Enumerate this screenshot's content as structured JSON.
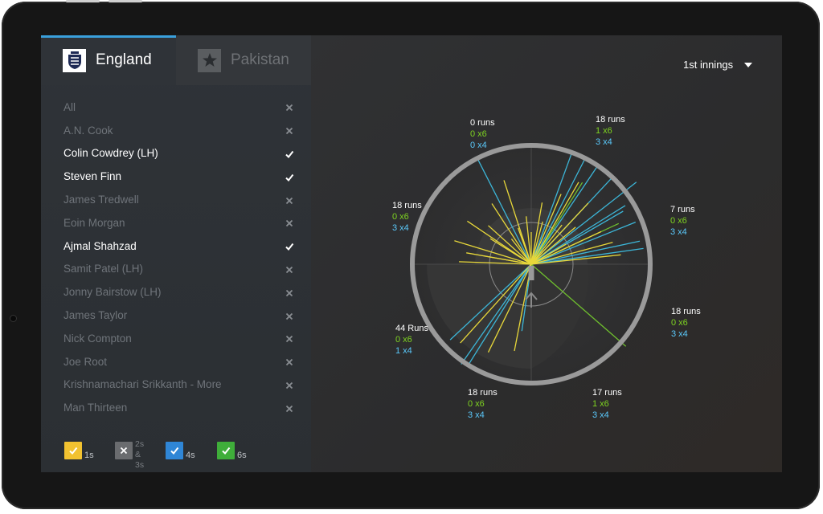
{
  "teams": [
    {
      "name": "England",
      "selected": true
    },
    {
      "name": "Pakistan",
      "selected": false
    }
  ],
  "innings": "1st innings",
  "players": [
    {
      "name": "All",
      "selected": false
    },
    {
      "name": "A.N. Cook",
      "selected": false
    },
    {
      "name": "Colin Cowdrey (LH)",
      "selected": true
    },
    {
      "name": "Steven Finn",
      "selected": true
    },
    {
      "name": "James Tredwell",
      "selected": false
    },
    {
      "name": "Eoin Morgan",
      "selected": false
    },
    {
      "name": "Ajmal Shahzad",
      "selected": true
    },
    {
      "name": "Samit Patel (LH)",
      "selected": false
    },
    {
      "name": "Jonny Bairstow (LH)",
      "selected": false
    },
    {
      "name": "James Taylor",
      "selected": false
    },
    {
      "name": "Nick Compton",
      "selected": false
    },
    {
      "name": "Joe Root",
      "selected": false
    },
    {
      "name": "Krishnamachari Srikkanth - More",
      "selected": false
    },
    {
      "name": "Man Thirteen",
      "selected": false
    }
  ],
  "legend": [
    {
      "label": "1s",
      "checked": true,
      "color": "#f2c230"
    },
    {
      "label": "2s",
      "label2": "& 3s",
      "checked": false,
      "color": "#6a6c6f"
    },
    {
      "label": "4s",
      "checked": true,
      "color": "#2f86d6"
    },
    {
      "label": "6s",
      "checked": true,
      "color": "#3fae3a"
    }
  ],
  "colors": {
    "ones": "#e8d83a",
    "fours": "#3cb6d8",
    "sixes": "#6fbf2e",
    "text_sixes": "#7ed321",
    "text_fours": "#5ac8fa"
  },
  "zones": [
    {
      "runs": "0 runs",
      "sixes": "0 x6",
      "fours": "0 x4"
    },
    {
      "runs": "18 runs",
      "sixes": "1 x6",
      "fours": "3 x4"
    },
    {
      "runs": "7 runs",
      "sixes": "0 x6",
      "fours": "3 x4"
    },
    {
      "runs": "18 runs",
      "sixes": "0 x6",
      "fours": "3 x4"
    },
    {
      "runs": "17 runs",
      "sixes": "1 x6",
      "fours": "3 x4"
    },
    {
      "runs": "18 runs",
      "sixes": "0 x6",
      "fours": "3 x4"
    },
    {
      "runs": "44 Runs",
      "sixes": "0 x6",
      "fours": "1 x4"
    },
    {
      "runs": "18 runs",
      "sixes": "0 x6",
      "fours": "3 x4"
    }
  ]
}
